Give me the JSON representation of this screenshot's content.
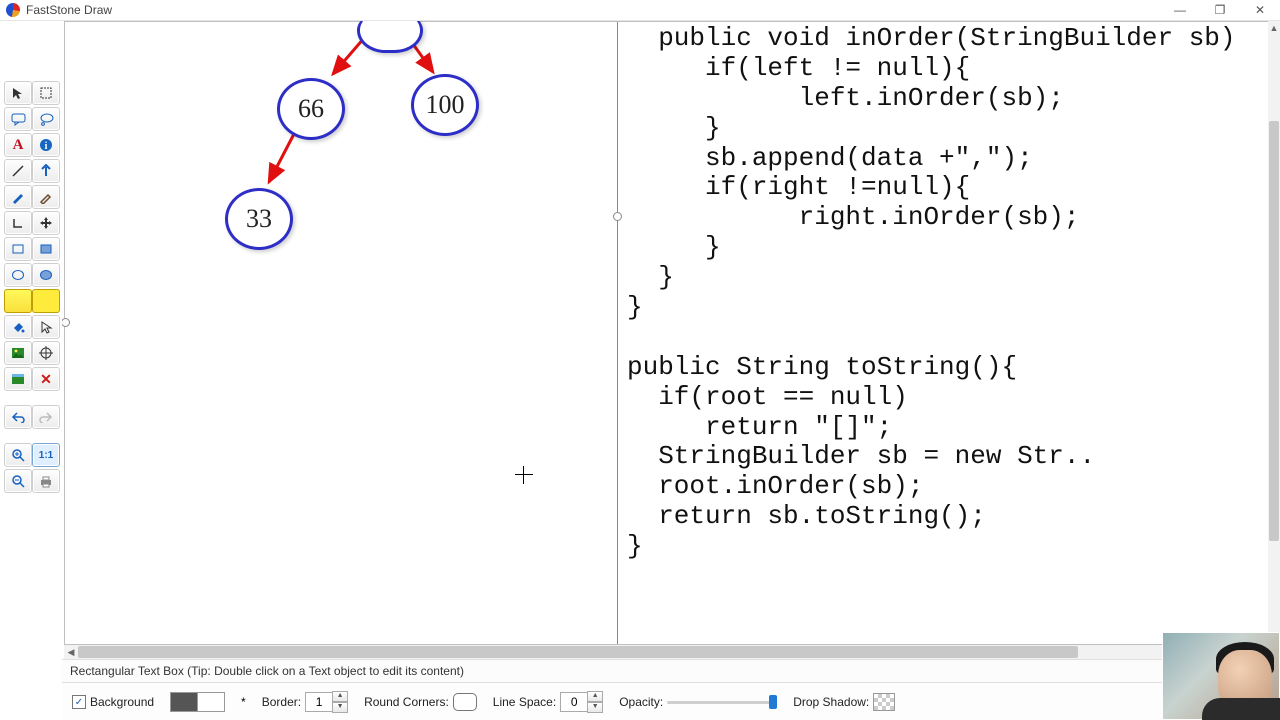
{
  "app": {
    "title": "FastStone Draw"
  },
  "window_buttons": {
    "min": "—",
    "max": "❐",
    "close": "✕"
  },
  "status": {
    "hint": "Rectangular Text Box (Tip: Double click on a Text object to edit its content)"
  },
  "options": {
    "background_label": "Background",
    "background_checked": "✓",
    "bg_star": "*",
    "border_label": "Border:",
    "border_value": "1",
    "round_label": "Round Corners:",
    "linespace_label": "Line Space:",
    "linespace_value": "0",
    "opacity_label": "Opacity:",
    "dropshadow_label": "Drop Shadow:"
  },
  "tools": [
    {
      "key": "select",
      "name": "select-tool"
    },
    {
      "key": "marquee",
      "name": "marquee-tool"
    },
    {
      "key": "speech",
      "name": "speech-bubble-tool"
    },
    {
      "key": "thought",
      "name": "thought-bubble-tool"
    },
    {
      "key": "text",
      "name": "text-tool"
    },
    {
      "key": "info",
      "name": "info-tool"
    },
    {
      "key": "line",
      "name": "line-tool"
    },
    {
      "key": "arrow-up",
      "name": "arrow-tool"
    },
    {
      "key": "pen",
      "name": "pen-tool"
    },
    {
      "key": "pencil",
      "name": "pencil-tool"
    },
    {
      "key": "lshape",
      "name": "lshape-tool"
    },
    {
      "key": "move",
      "name": "move-tool"
    },
    {
      "key": "rect",
      "name": "rect-tool"
    },
    {
      "key": "rectfill",
      "name": "rect-fill-tool"
    },
    {
      "key": "ellipse",
      "name": "ellipse-tool"
    },
    {
      "key": "ellipsefill",
      "name": "ellipse-fill-tool"
    },
    {
      "key": "hl1",
      "name": "highlight-tool"
    },
    {
      "key": "hl2",
      "name": "highlight-fill-tool"
    },
    {
      "key": "bucket",
      "name": "bucket-tool"
    },
    {
      "key": "cursor2",
      "name": "pointer-tool"
    },
    {
      "key": "image",
      "name": "image-tool"
    },
    {
      "key": "target",
      "name": "target-tool"
    },
    {
      "key": "palette",
      "name": "palette-tool"
    },
    {
      "key": "delete",
      "name": "delete-tool"
    }
  ],
  "tools2": [
    {
      "key": "undo",
      "name": "undo-tool"
    },
    {
      "key": "redo",
      "name": "redo-tool"
    }
  ],
  "tools3": [
    {
      "key": "zoomin",
      "name": "zoom-in-tool"
    },
    {
      "key": "scale11",
      "name": "scale-11-tool",
      "sel": true,
      "label": "1:1"
    },
    {
      "key": "zoomout",
      "name": "zoom-out-tool"
    },
    {
      "key": "print",
      "name": "print-tool"
    }
  ],
  "tree": {
    "nodes": {
      "root": "",
      "left": "66",
      "right": "100",
      "leftleft": "33"
    }
  },
  "code": "  public void inOrder(StringBuilder sb)\n     if(left != null){\n           left.inOrder(sb);\n     }\n     sb.append(data +\",\");\n     if(right !=null){\n           right.inOrder(sb);\n     }\n  }\n}\n\npublic String toString(){\n  if(root == null)\n     return \"[]\";\n  StringBuilder sb = new Str..\n  root.inOrder(sb);\n  return sb.toString();\n}"
}
